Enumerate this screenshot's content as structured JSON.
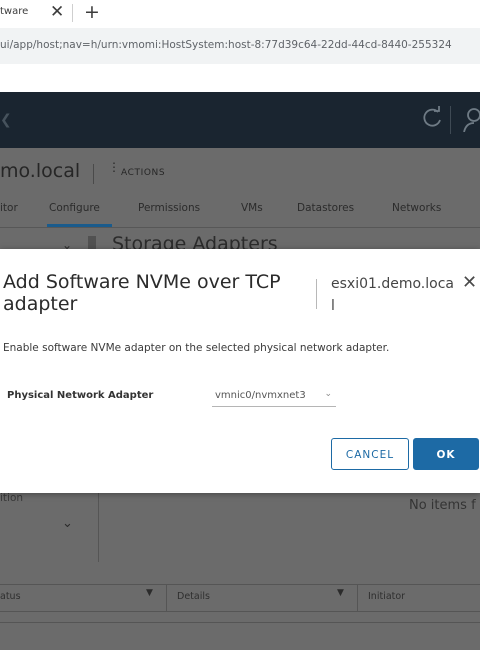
{
  "browser": {
    "tab_title": "tware",
    "tab_close": "✕",
    "new_tab": "+",
    "address": "ui/app/host;nav=h/urn:vmomi:HostSystem:host-8:77d39c64-22dd-44cd-8440-255324"
  },
  "app": {
    "host_title": "mo.local",
    "actions_label": "ACTIONS",
    "tabs": [
      "itor",
      "Configure",
      "Permissions",
      "VMs",
      "Datastores",
      "Networks"
    ],
    "active_tab": "Configure",
    "section_title": "Storage Adapters",
    "lower_left_label": "ition",
    "no_items_text": "No items f",
    "table_headers": [
      "atus",
      "Details",
      "Initiator"
    ]
  },
  "modal": {
    "title": "Add Software NVMe over TCP adapter",
    "host": "esxi01.demo.local",
    "close_icon": "✕",
    "description": "Enable software NVMe adapter on the selected physical network adapter.",
    "field_label": "Physical Network Adapter",
    "field_value": "vmnic0/nvmxnet3",
    "cancel_label": "CANCEL",
    "ok_label": "OK"
  },
  "colors": {
    "primary": "#1d6aa5",
    "header_bg": "#1a2530",
    "overlay_bg": "#6b6b6b"
  }
}
